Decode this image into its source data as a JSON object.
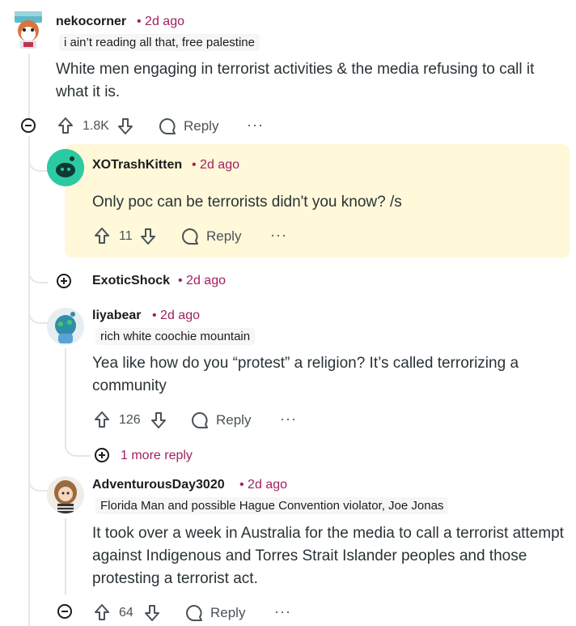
{
  "comments": [
    {
      "user": "nekocorner",
      "time": "• 2d ago",
      "flair": "i ain’t reading all that, free palestine",
      "text": "White men engaging in terrorist activities & the media refusing to call it what it is.",
      "votes": "1.8K",
      "reply": "Reply",
      "more": "···"
    },
    {
      "user": "XOTrashKitten",
      "time": "• 2d ago",
      "text": "Only poc can be terrorists didn't you know? /s",
      "votes": "11",
      "reply": "Reply",
      "more": "···"
    },
    {
      "user": "ExoticShock",
      "time": "• 2d ago"
    },
    {
      "user": "liyabear",
      "time": "• 2d ago",
      "flair": "rich white coochie mountain",
      "text": "Yea like how do you “protest” a religion? It’s called terrorizing a community",
      "votes": "126",
      "reply": "Reply",
      "more": "···",
      "more_replies": "1 more reply"
    },
    {
      "user": "AdventurousDay3020",
      "time": "• 2d ago",
      "flair": "Florida Man and possible Hague Convention violator, Joe Jonas",
      "text": "It took over a week in Australia for the media to call a terrorist attempt against Indigenous and Torres Strait Islander peoples and those protesting a terrorist act.",
      "votes": "64",
      "reply": "Reply",
      "more": "···"
    }
  ],
  "colors": {
    "highlight": "#fff8d9",
    "meta": "#a31f61",
    "text": "#2a3236"
  }
}
